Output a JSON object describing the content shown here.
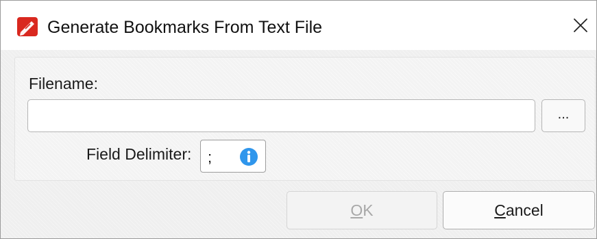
{
  "window": {
    "title": "Generate Bookmarks From Text File",
    "app_icon": "pdf-editor-app-icon",
    "close_icon": "close-icon"
  },
  "form": {
    "filename_label": "Filename:",
    "filename_value": "",
    "browse_label": "...",
    "delimiter_label": "Field Delimiter:",
    "delimiter_value": ";",
    "info_icon": "info-icon"
  },
  "buttons": {
    "ok_mnemonic": "O",
    "ok_rest": "K",
    "ok_enabled": false,
    "cancel_mnemonic": "C",
    "cancel_rest": "ancel"
  },
  "colors": {
    "brand_red": "#d9281f",
    "info_blue": "#2f96ec",
    "disabled_text": "#a8a8a8"
  }
}
